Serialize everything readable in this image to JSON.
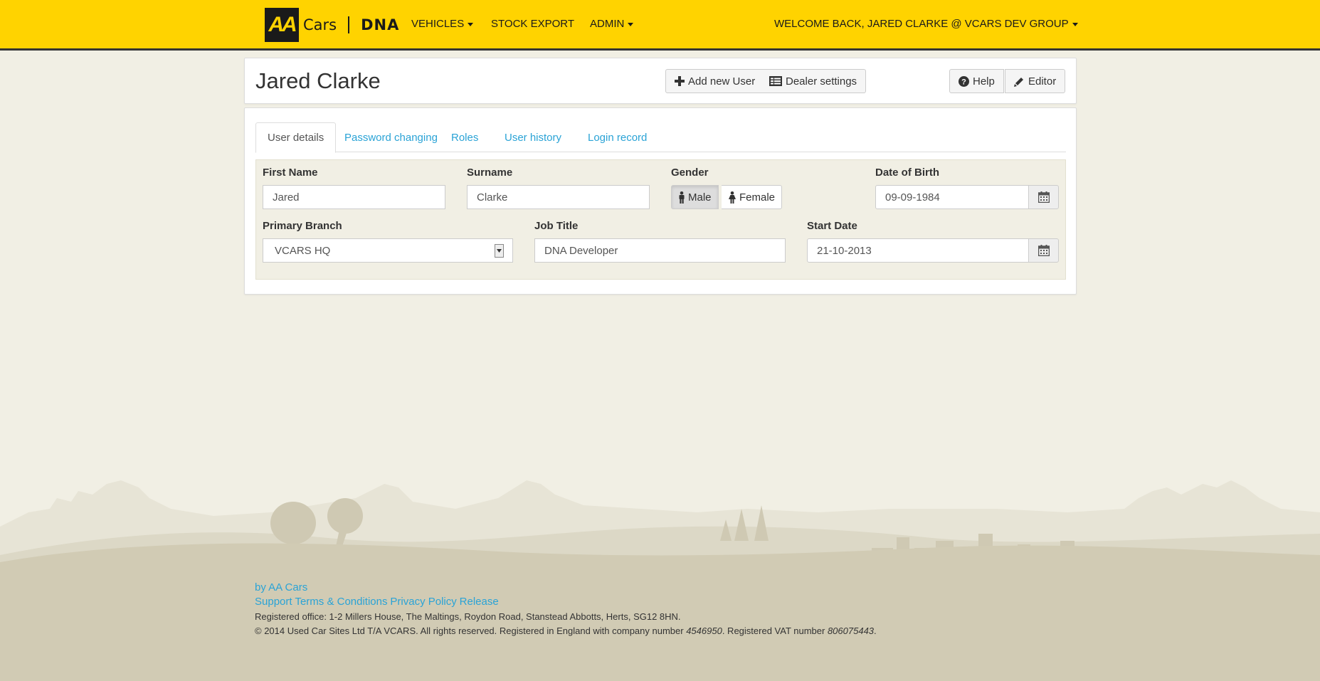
{
  "brand": {
    "logo_text": "AA",
    "cars": "Cars",
    "product": "DNA"
  },
  "nav": {
    "vehicles": "VEHICLES",
    "stock_export": "STOCK EXPORT",
    "admin": "ADMIN",
    "welcome": "WELCOME BACK, JARED CLARKE @ VCARS DEV GROUP"
  },
  "header": {
    "title": "Jared Clarke",
    "add_user": "Add new User",
    "dealer_settings": "Dealer settings",
    "help": "Help",
    "editor": "Editor"
  },
  "tabs": [
    {
      "label": "User details",
      "active": true
    },
    {
      "label": "Password changing",
      "active": false
    },
    {
      "label": "Roles",
      "active": false
    },
    {
      "label": "User history",
      "active": false
    },
    {
      "label": "Login record",
      "active": false
    }
  ],
  "form": {
    "first_name": {
      "label": "First Name",
      "value": "Jared"
    },
    "surname": {
      "label": "Surname",
      "value": "Clarke"
    },
    "gender": {
      "label": "Gender",
      "male": "Male",
      "female": "Female",
      "selected": "Male"
    },
    "dob": {
      "label": "Date of Birth",
      "value": "09-09-1984"
    },
    "branch": {
      "label": "Primary Branch",
      "value": "VCARS HQ"
    },
    "job_title": {
      "label": "Job Title",
      "value": "DNA Developer"
    },
    "start_date": {
      "label": "Start Date",
      "value": "21-10-2013"
    }
  },
  "footer": {
    "by": "by AA Cars",
    "links": [
      "Support",
      "Terms & Conditions",
      "Privacy Policy",
      "Release"
    ],
    "registered_office": "Registered office: 1-2 Millers House, The Maltings, Roydon Road, Stanstead Abbotts, Herts, SG12 8HN.",
    "copyright_prefix": "© 2014 Used Car Sites Ltd T/A VCARS. All rights reserved. Registered in England with company number ",
    "company_number": "4546950",
    "vat_prefix": ". Registered VAT number ",
    "vat_number": "806075443",
    "suffix": "."
  },
  "colors": {
    "navbar": "#ffd300",
    "link": "#2aa3d6",
    "background": "#f1efe4",
    "footer": "#d1cbb4"
  }
}
